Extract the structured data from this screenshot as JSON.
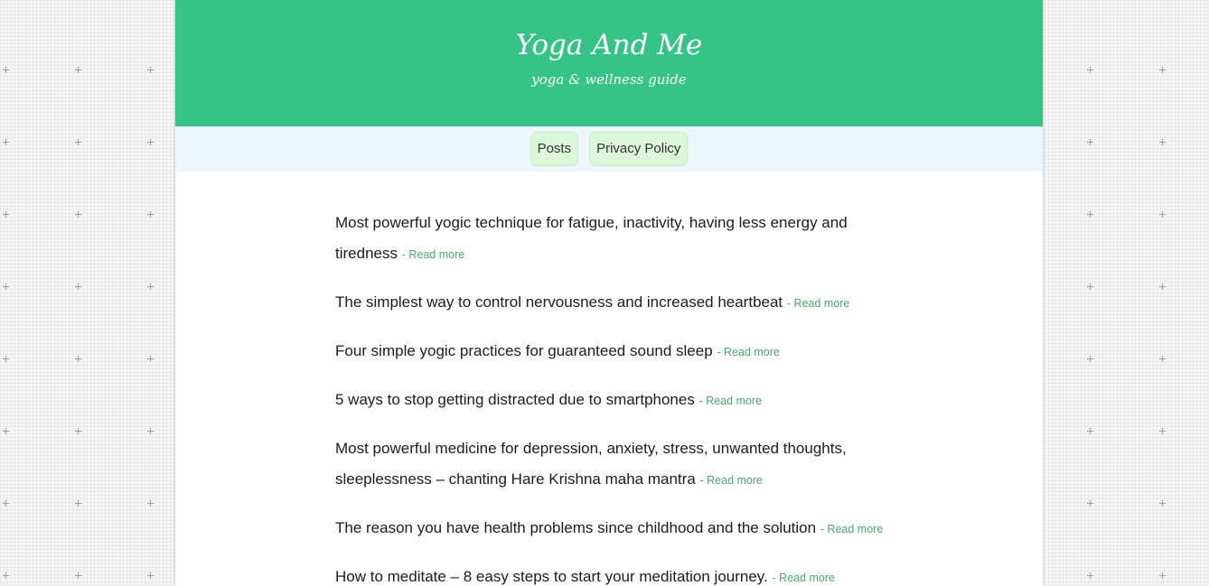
{
  "site": {
    "title": "Yoga And Me",
    "tagline": "yoga & wellness guide"
  },
  "nav": {
    "items": [
      "Posts",
      "Privacy Policy"
    ]
  },
  "read_more_label": "- Read more",
  "posts": [
    "Most powerful yogic technique for fatigue, inactivity, having less energy and tiredness",
    "The simplest way to control nervousness and increased heartbeat",
    "Four simple yogic practices for guaranteed sound sleep",
    "5 ways to stop getting distracted due to smartphones",
    "Most powerful medicine for depression, anxiety, stress, unwanted thoughts, sleeplessness – chanting Hare Krishna maha mantra",
    "The reason you have health problems since childhood and the solution",
    "How to meditate – 8 easy steps to start your meditation journey."
  ],
  "colors": {
    "header_bg": "#35c486",
    "nav_bg": "#eef6fd",
    "nav_button_bg": "#dcf7d8",
    "read_more": "#4aa96b"
  }
}
